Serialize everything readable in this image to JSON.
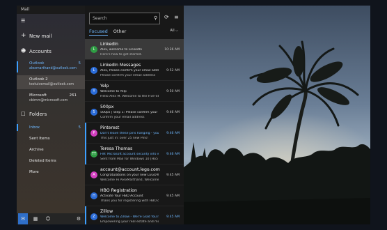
{
  "app": {
    "title": "Mail"
  },
  "nav": {
    "new_mail": "New mail",
    "accounts_label": "Accounts",
    "accounts": [
      {
        "name": "Outlook",
        "email": "alexmarthand@outlook.com",
        "count": "5"
      },
      {
        "name": "Outlook 2",
        "email": "testuivemail@outlook.com",
        "count": ""
      },
      {
        "name": "Microsoft",
        "email": "cbimm@microsoft.com",
        "count": "261"
      }
    ],
    "folders_label": "Folders",
    "folders": [
      {
        "name": "Inbox",
        "count": "5"
      },
      {
        "name": "Sent Items",
        "count": ""
      },
      {
        "name": "Archive",
        "count": ""
      },
      {
        "name": "Deleted Items",
        "count": ""
      },
      {
        "name": "More",
        "count": ""
      }
    ]
  },
  "list": {
    "search_placeholder": "Search",
    "tab_focused": "Focused",
    "tab_other": "Other",
    "filter": "All",
    "messages": [
      {
        "sender": "LinkedIn",
        "subject": "Alex, welcome to LinkedIn",
        "preview": "Here's how to get started.",
        "time": "10:26 AM",
        "initial": "L",
        "color": "#2f9e44",
        "unread": false,
        "selected": true
      },
      {
        "sender": "LinkedIn Messages",
        "subject": "Alex, Please confirm your email address",
        "preview": "Please confirm your email address",
        "time": "9:52 AM",
        "initial": "L",
        "color": "#2b6cd8",
        "unread": false,
        "selected": false
      },
      {
        "sender": "Yelp",
        "subject": "Welcome to Yelp",
        "preview": "Hello Alex M. Welcome to the Five-Star I",
        "time": "9:50 AM",
        "initial": "Y",
        "color": "#2b6cd8",
        "unread": false,
        "selected": false
      },
      {
        "sender": "500px",
        "subject": "500px | Step 1: Please confirm your email a",
        "preview": "Confirm your email address",
        "time": "9:46 AM",
        "initial": "5",
        "color": "#2b6cd8",
        "unread": false,
        "selected": false
      },
      {
        "sender": "Pinterest",
        "subject": "Don't leave these pins hanging - you're go",
        "preview": "This just in: over 25 new Pins!",
        "time": "9:46 AM",
        "initial": "P",
        "color": "#d43fc0",
        "unread": true,
        "selected": false
      },
      {
        "sender": "Teresa Thomas",
        "subject": "FW: Microsoft account security info was ac",
        "preview": "Sent from Mail for Windows 10 [Ho5 - 10",
        "time": "9:46 AM",
        "initial": "TT",
        "color": "#2f9e44",
        "unread": true,
        "selected": false
      },
      {
        "sender": "account@account.lego.com",
        "subject": "Congratulations on your new LEGO® ID",
        "preview": "Welcome Hi AlexMarthand, Welcome to",
        "time": "9:45 AM",
        "initial": "A",
        "color": "#d43fc0",
        "unread": false,
        "selected": false
      },
      {
        "sender": "HBO Registration",
        "subject": "Activate Your HBO Account",
        "preview": "Thank you for registering with HBO.com, c",
        "time": "9:45 AM",
        "initial": "H",
        "color": "#2b6cd8",
        "unread": false,
        "selected": false
      },
      {
        "sender": "Zillow",
        "subject": "Welcome to Zillow - We're Glad You're Here",
        "preview": "Empowering your real estate and mortgag",
        "time": "9:45 AM",
        "initial": "Z",
        "color": "#2b6cd8",
        "unread": true,
        "selected": false
      }
    ]
  }
}
